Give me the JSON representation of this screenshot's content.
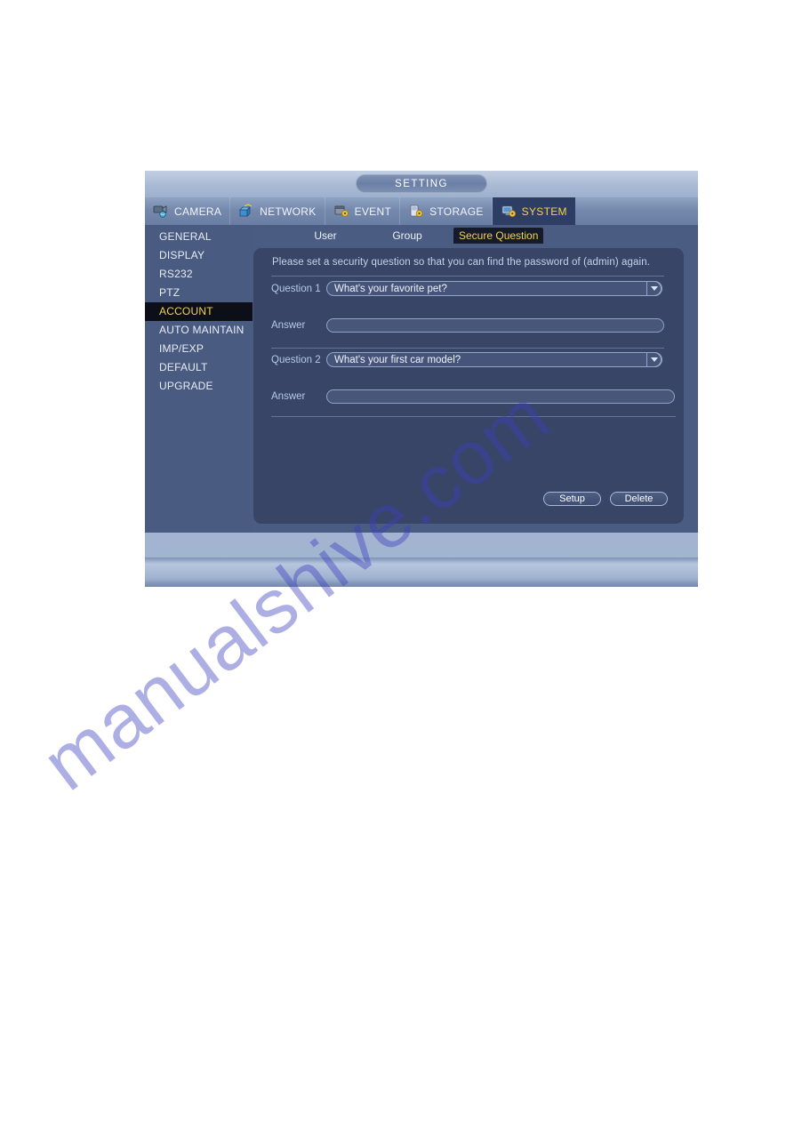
{
  "window": {
    "title": "SETTING"
  },
  "top_tabs": [
    {
      "label": "CAMERA",
      "icon": "camera-icon",
      "active": false
    },
    {
      "label": "NETWORK",
      "icon": "network-icon",
      "active": false
    },
    {
      "label": "EVENT",
      "icon": "event-icon",
      "active": false
    },
    {
      "label": "STORAGE",
      "icon": "storage-icon",
      "active": false
    },
    {
      "label": "SYSTEM",
      "icon": "system-icon",
      "active": true
    }
  ],
  "sidebar": {
    "items": [
      {
        "label": "GENERAL",
        "active": false
      },
      {
        "label": "DISPLAY",
        "active": false
      },
      {
        "label": "RS232",
        "active": false
      },
      {
        "label": "PTZ",
        "active": false
      },
      {
        "label": "ACCOUNT",
        "active": true
      },
      {
        "label": "AUTO MAINTAIN",
        "active": false
      },
      {
        "label": "IMP/EXP",
        "active": false
      },
      {
        "label": "DEFAULT",
        "active": false
      },
      {
        "label": "UPGRADE",
        "active": false
      }
    ]
  },
  "sub_tabs": [
    {
      "label": "User",
      "active": false
    },
    {
      "label": "Group",
      "active": false
    },
    {
      "label": "Secure Question",
      "active": true
    }
  ],
  "panel": {
    "note": "Please set a security question so that you can find the password of (admin) again.",
    "fields": {
      "question1_label": "Question 1",
      "question1_value": "What's your favorite pet?",
      "answer1_label": "Answer",
      "answer1_value": "",
      "answer1_placeholder": "",
      "question2_label": "Question 2",
      "question2_value": "What's your first car model?",
      "answer2_label": "Answer",
      "answer2_value": "",
      "answer2_placeholder": ""
    },
    "buttons": {
      "setup": "Setup",
      "delete": "Delete"
    }
  },
  "watermark": {
    "text": "manualshive.com"
  },
  "colors": {
    "accent_yellow": "#f5d24a",
    "window_body": "#4b5c82",
    "panel": "#384567",
    "active_item": "#0c0f18"
  }
}
